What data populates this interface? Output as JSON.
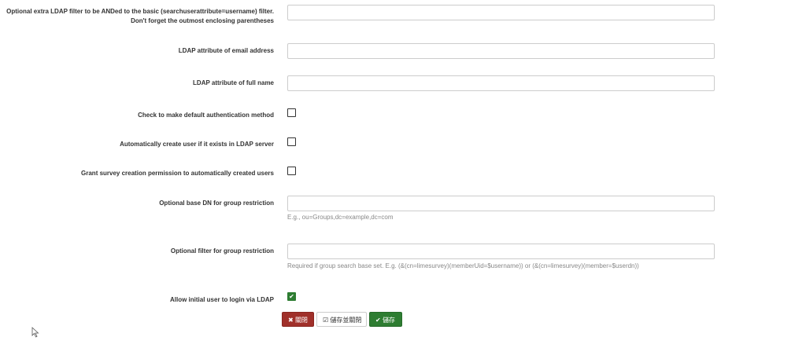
{
  "fields": {
    "extra_filter": {
      "label_line1": "Optional extra LDAP filter to be ANDed to the basic (searchuserattribute=username) filter.",
      "label_line2": "Don't forget the outmost enclosing parentheses",
      "value": ""
    },
    "email_attr": {
      "label": "LDAP attribute of email address",
      "value": ""
    },
    "fullname_attr": {
      "label": "LDAP attribute of full name",
      "value": ""
    },
    "default_auth": {
      "label": "Check to make default authentication method",
      "checked": false
    },
    "auto_create": {
      "label": "Automatically create user if it exists in LDAP server",
      "checked": false
    },
    "grant_survey": {
      "label": "Grant survey creation permission to automatically created users",
      "checked": false
    },
    "group_base_dn": {
      "label": "Optional base DN for group restriction",
      "value": "",
      "help": "E.g., ou=Groups,dc=example,dc=com"
    },
    "group_filter": {
      "label": "Optional filter for group restriction",
      "value": "",
      "help": "Required if group search base set. E.g. (&(cn=limesurvey)(memberUid=$username)) or (&(cn=limesurvey)(member=$userdn))"
    },
    "allow_initial": {
      "label": "Allow initial user to login via LDAP",
      "checked": true
    }
  },
  "buttons": {
    "close": {
      "icon": "✖",
      "label": "關閉"
    },
    "save_close": {
      "icon": "☑",
      "label": "儲存並關閉"
    },
    "save": {
      "icon": "✔",
      "label": "儲存"
    }
  },
  "colors": {
    "danger": "#a0302a",
    "success": "#2e7d32"
  }
}
